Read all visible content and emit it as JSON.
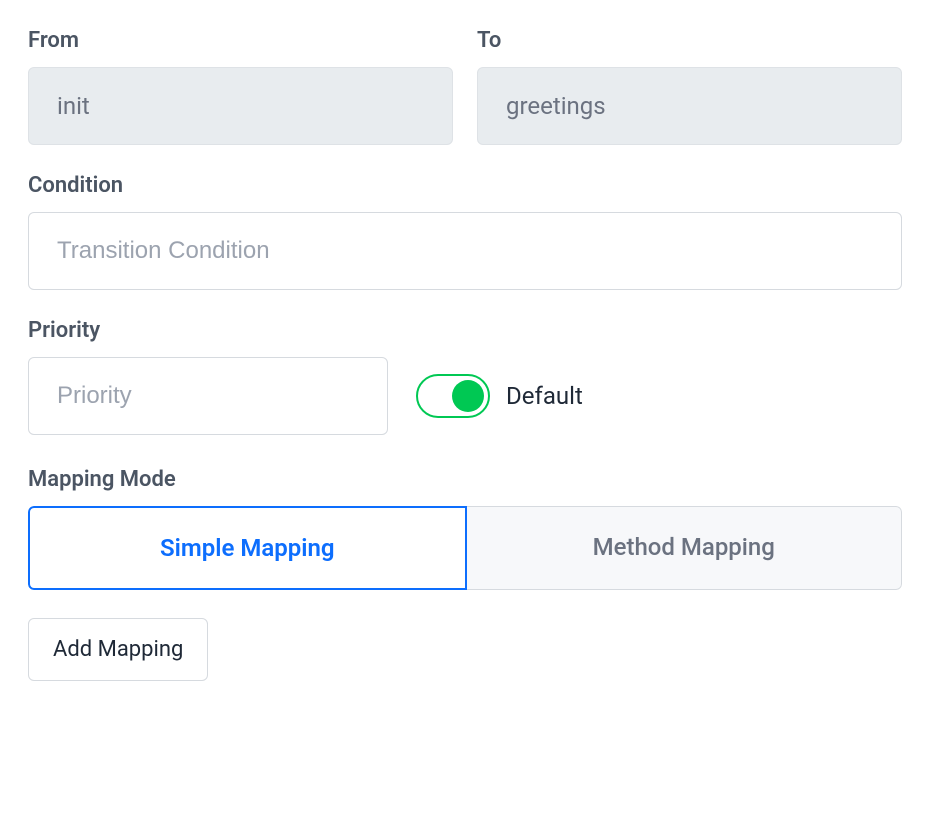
{
  "from": {
    "label": "From",
    "value": "init"
  },
  "to": {
    "label": "To",
    "value": "greetings"
  },
  "condition": {
    "label": "Condition",
    "placeholder": "Transition Condition",
    "value": ""
  },
  "priority": {
    "label": "Priority",
    "placeholder": "Priority",
    "value": "",
    "default_toggle_label": "Default",
    "default_toggle_on": true
  },
  "mapping_mode": {
    "label": "Mapping Mode",
    "tabs": [
      {
        "label": "Simple Mapping",
        "active": true
      },
      {
        "label": "Method Mapping",
        "active": false
      }
    ]
  },
  "add_mapping_button": "Add Mapping"
}
